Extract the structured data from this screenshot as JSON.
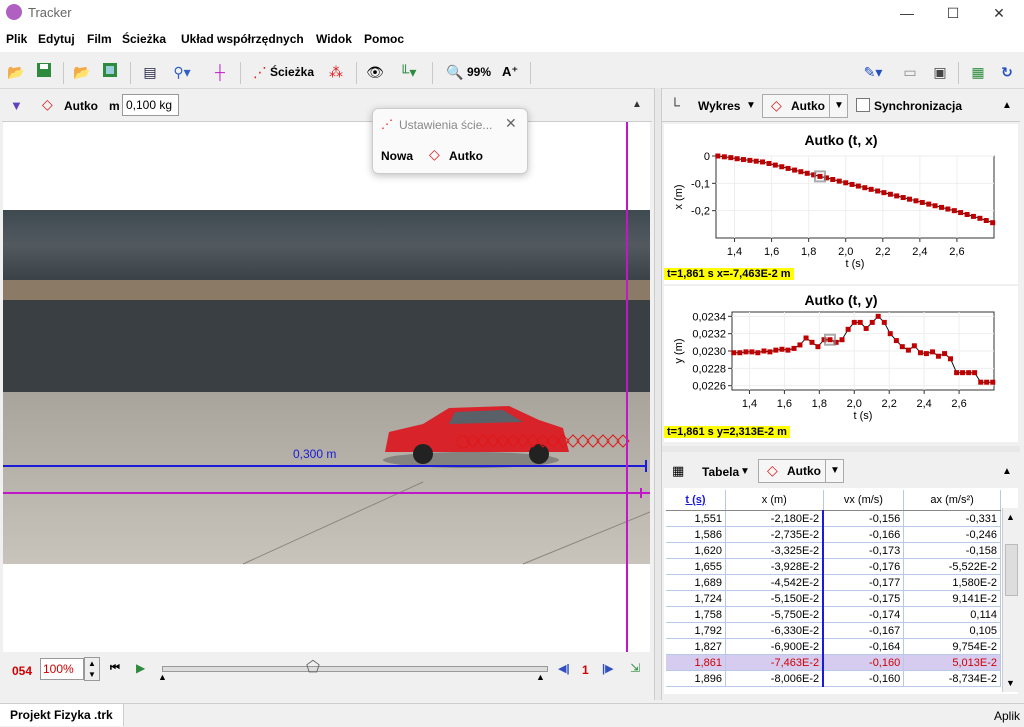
{
  "window": {
    "title": "Tracker",
    "minimize": "—",
    "maximize": "☐",
    "close": "✕"
  },
  "menu": [
    "Plik",
    "Edytuj",
    "Film",
    "Ścieżka",
    "Układ współrzędnych",
    "Widok",
    "Pomoc"
  ],
  "toolbar": {
    "track_label": "Ścieżka",
    "zoom": "99%",
    "font_btn": "A⁺"
  },
  "trackbar": {
    "track_name": "Autko",
    "mass_label": "m",
    "mass_value": "0,100 kg"
  },
  "popup": {
    "title": "Ustawienia ście...",
    "new_label": "Nowa",
    "track": "Autko"
  },
  "video": {
    "calibration_label": "0,300 m"
  },
  "player": {
    "frame": "054",
    "zoom": "100%",
    "step": "1"
  },
  "plot_pane": {
    "view_label": "Wykres",
    "track": "Autko",
    "sync_label": "Synchronizacja"
  },
  "charts": [
    {
      "title": "Autko (t, x)",
      "xlabel": "t (s)",
      "ylabel": "x (m)",
      "xticks": [
        "1,4",
        "1,6",
        "1,8",
        "2,0",
        "2,2",
        "2,4",
        "2,6"
      ],
      "yticks": [
        "0",
        "-0,1",
        "-0,2"
      ],
      "readout": "t=1,861 s  x=-7,463E-2 m"
    },
    {
      "title": "Autko (t, y)",
      "xlabel": "t (s)",
      "ylabel": "y (m)",
      "xticks": [
        "1,4",
        "1,6",
        "1,8",
        "2,0",
        "2,2",
        "2,4",
        "2,6"
      ],
      "yticks": [
        "0,0234",
        "0,0232",
        "0,0230",
        "0,0228",
        "0,0226"
      ],
      "readout": "t=1,861 s  y=2,313E-2 m"
    }
  ],
  "chart_data": [
    {
      "type": "line",
      "title": "Autko (t, x)",
      "xlabel": "t (s)",
      "ylabel": "x (m)",
      "xlim": [
        1.3,
        2.8
      ],
      "ylim": [
        -0.3,
        0.0
      ],
      "x": [
        1.31,
        1.345,
        1.38,
        1.414,
        1.448,
        1.483,
        1.517,
        1.551,
        1.586,
        1.62,
        1.655,
        1.689,
        1.724,
        1.758,
        1.792,
        1.827,
        1.861,
        1.896,
        1.93,
        1.965,
        2.0,
        2.034,
        2.068,
        2.103,
        2.137,
        2.172,
        2.206,
        2.241,
        2.275,
        2.31,
        2.344,
        2.379,
        2.413,
        2.448,
        2.482,
        2.517,
        2.551,
        2.586,
        2.62,
        2.655,
        2.689,
        2.724,
        2.758,
        2.793
      ],
      "y": [
        0.0,
        -0.003,
        -0.006,
        -0.01,
        -0.013,
        -0.016,
        -0.019,
        -0.0218,
        -0.02735,
        -0.03325,
        -0.03928,
        -0.04542,
        -0.0515,
        -0.0575,
        -0.0633,
        -0.069,
        -0.07463,
        -0.08006,
        -0.086,
        -0.092,
        -0.098,
        -0.104,
        -0.11,
        -0.116,
        -0.122,
        -0.128,
        -0.134,
        -0.14,
        -0.146,
        -0.152,
        -0.158,
        -0.164,
        -0.17,
        -0.176,
        -0.182,
        -0.188,
        -0.194,
        -0.2,
        -0.207,
        -0.214,
        -0.221,
        -0.228,
        -0.236,
        -0.244
      ]
    },
    {
      "type": "line",
      "title": "Autko (t, y)",
      "xlabel": "t (s)",
      "ylabel": "y (m)",
      "xlim": [
        1.3,
        2.8
      ],
      "ylim": [
        0.02255,
        0.02345
      ],
      "x": [
        1.31,
        1.345,
        1.38,
        1.414,
        1.448,
        1.483,
        1.517,
        1.551,
        1.586,
        1.62,
        1.655,
        1.689,
        1.724,
        1.758,
        1.792,
        1.827,
        1.861,
        1.896,
        1.93,
        1.965,
        2.0,
        2.034,
        2.068,
        2.103,
        2.137,
        2.172,
        2.206,
        2.241,
        2.275,
        2.31,
        2.344,
        2.379,
        2.413,
        2.448,
        2.482,
        2.517,
        2.551,
        2.586,
        2.62,
        2.655,
        2.689,
        2.724,
        2.758,
        2.793
      ],
      "y": [
        0.02298,
        0.02298,
        0.02299,
        0.02299,
        0.02298,
        0.023,
        0.02299,
        0.02301,
        0.02302,
        0.02301,
        0.02303,
        0.02307,
        0.02315,
        0.0231,
        0.02305,
        0.02313,
        0.02313,
        0.0231,
        0.02313,
        0.02325,
        0.02333,
        0.02333,
        0.02326,
        0.02333,
        0.0234,
        0.02333,
        0.0232,
        0.02312,
        0.02305,
        0.02301,
        0.02306,
        0.02298,
        0.02297,
        0.02299,
        0.02294,
        0.02297,
        0.02291,
        0.02275,
        0.02275,
        0.02275,
        0.02275,
        0.02264,
        0.02264,
        0.02264
      ]
    }
  ],
  "table_pane": {
    "view_label": "Tabela",
    "track": "Autko"
  },
  "table": {
    "headers": [
      "t (s)",
      "x (m)",
      "vx (m/s)",
      "ax (m/s²)"
    ],
    "rows": [
      [
        "1,551",
        "-2,180E-2",
        "-0,156",
        "-0,331"
      ],
      [
        "1,586",
        "-2,735E-2",
        "-0,166",
        "-0,246"
      ],
      [
        "1,620",
        "-3,325E-2",
        "-0,173",
        "-0,158"
      ],
      [
        "1,655",
        "-3,928E-2",
        "-0,176",
        "-5,522E-2"
      ],
      [
        "1,689",
        "-4,542E-2",
        "-0,177",
        "1,580E-2"
      ],
      [
        "1,724",
        "-5,150E-2",
        "-0,175",
        "9,141E-2"
      ],
      [
        "1,758",
        "-5,750E-2",
        "-0,174",
        "0,114"
      ],
      [
        "1,792",
        "-6,330E-2",
        "-0,167",
        "0,105"
      ],
      [
        "1,827",
        "-6,900E-2",
        "-0,164",
        "9,754E-2"
      ],
      [
        "1,861",
        "-7,463E-2",
        "-0,160",
        "5,013E-2"
      ],
      [
        "1,896",
        "-8,006E-2",
        "-0,160",
        "-8,734E-2"
      ]
    ],
    "selected_row": 9
  },
  "status": {
    "tab": "Projekt Fizyka .trk",
    "right": "Aplik"
  },
  "colors": {
    "accent_red": "#e01818",
    "calibration_blue": "#1a1ad8",
    "axis_magenta": "#c018c8",
    "readout_bg": "#ffff00"
  }
}
